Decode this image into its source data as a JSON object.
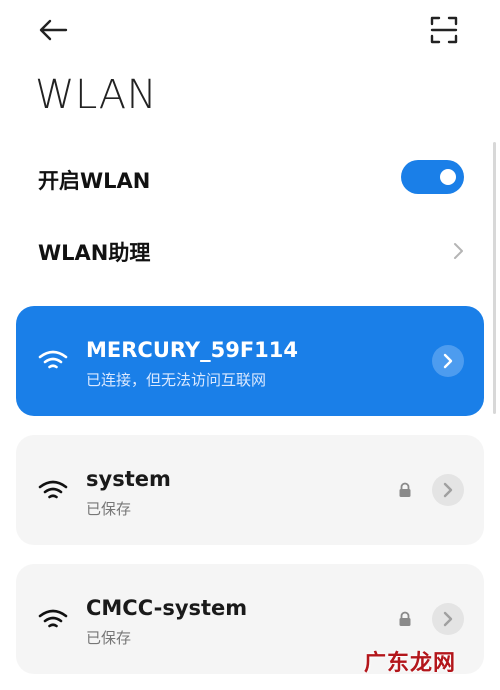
{
  "header": {
    "back_icon": "arrow-left-icon",
    "scan_icon": "scan-qr-icon"
  },
  "page": {
    "title": "WLAN"
  },
  "settings": {
    "wlan_toggle_label": "开启WLAN",
    "wlan_enabled": true,
    "assistant_label": "WLAN助理"
  },
  "networks": [
    {
      "name": "MERCURY_59F114",
      "status": "已连接，但无法访问互联网",
      "connected": true,
      "locked": false
    },
    {
      "name": "system",
      "status": "已保存",
      "connected": false,
      "locked": true
    },
    {
      "name": "CMCC-system",
      "status": "已保存",
      "connected": false,
      "locked": true
    }
  ],
  "watermark": "广东龙网",
  "colors": {
    "accent": "#1a7fe8",
    "card": "#f5f5f5",
    "watermark": "#b3161b"
  }
}
